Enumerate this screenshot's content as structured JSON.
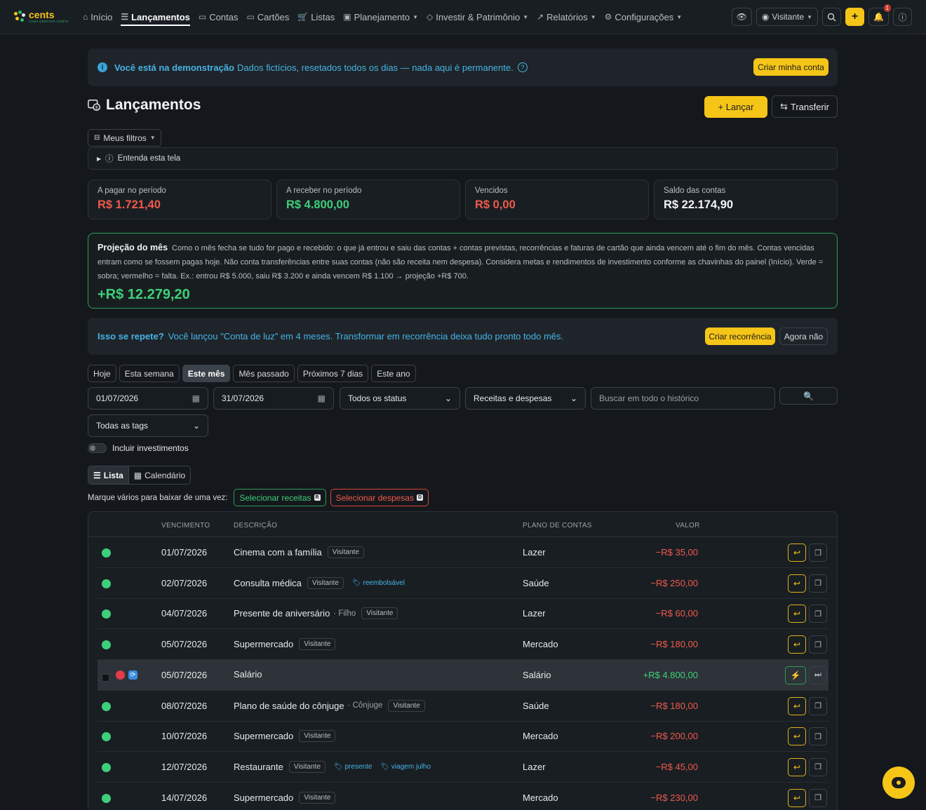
{
  "nav": {
    "logo": "cents",
    "logo_tagline": "CADA CENTAVO CONTA",
    "items": [
      {
        "label": "Início",
        "icon": "home-icon"
      },
      {
        "label": "Lançamentos",
        "icon": "list-icon"
      },
      {
        "label": "Contas",
        "icon": "folder-icon"
      },
      {
        "label": "Cartões",
        "icon": "card-icon"
      },
      {
        "label": "Listas",
        "icon": "cart-icon"
      },
      {
        "label": "Planejamento",
        "icon": "calendar-check-icon"
      },
      {
        "label": "Investir & Patrimônio",
        "icon": "gem-icon"
      },
      {
        "label": "Relatórios",
        "icon": "chart-icon"
      },
      {
        "label": "Configurações",
        "icon": "gear-icon"
      }
    ],
    "user": "Visitante",
    "notifications": "1"
  },
  "demo": {
    "title": "Você está na demonstração",
    "text": "Dados fictícios, resetados todos os dias — nada aqui é permanente.",
    "cta": "Criar minha conta"
  },
  "page": {
    "title": "Lançamentos",
    "launch": "+ Lançar",
    "transfer": "Transferir",
    "my_filters": "Meus filtros",
    "understand": "Entenda esta tela"
  },
  "summary": [
    {
      "label": "A pagar no período",
      "value": "R$ 1.721,40",
      "tone": "red"
    },
    {
      "label": "A receber no período",
      "value": "R$ 4.800,00",
      "tone": "green"
    },
    {
      "label": "Vencidos",
      "value": "R$ 0,00",
      "tone": "red"
    },
    {
      "label": "Saldo das contas",
      "value": "R$ 22.174,90",
      "tone": "white"
    }
  ],
  "projection": {
    "title": "Projeção do mês",
    "text": "Como o mês fecha se tudo for pago e recebido: o que já entrou e saiu das contas + contas previstas, recorrências e faturas de cartão que ainda vencem até o fim do mês. Contas vencidas entram como se fossem pagas hoje. Não conta transferências entre suas contas (não são receita nem despesa). Considera metas e rendimentos de investimento conforme as chavinhas do painel (Início). Verde = sobra; vermelho = falta. Ex.: entrou R$ 5.000, saiu R$ 3.200 e ainda vencem R$ 1.100 → projeção +R$ 700.",
    "value": "+R$ 12.279,20"
  },
  "recurrence": {
    "title": "Isso se repete?",
    "text": "Você lançou \"Conta de luz\" em 4 meses. Transformar em recorrência deixa tudo pronto todo mês.",
    "create": "Criar recorrência",
    "dismiss": "Agora não"
  },
  "periods": [
    "Hoje",
    "Esta semana",
    "Este mês",
    "Mês passado",
    "Próximos 7 dias",
    "Este ano"
  ],
  "filters": {
    "date_from": "01/07/2026",
    "date_to": "31/07/2026",
    "status": "Todos os status",
    "type": "Receitas e despesas",
    "search_placeholder": "Buscar em todo o histórico",
    "tags": "Todas as tags",
    "include_investments": "Incluir investimentos"
  },
  "views": {
    "list": "Lista",
    "calendar": "Calendário"
  },
  "bulk": {
    "label": "Marque vários para baixar de uma vez:",
    "select_income": "Selecionar receitas",
    "income_key": "R",
    "select_expense": "Selecionar despesas",
    "expense_key": "D"
  },
  "table": {
    "headers": {
      "due": "VENCIMENTO",
      "desc": "DESCRIÇÃO",
      "plan": "PLANO DE CONTAS",
      "value": "VALOR"
    },
    "rows": [
      {
        "date": "01/07/2026",
        "desc": "Cinema com a família",
        "sub": "",
        "pill": "Visitante",
        "tags": [],
        "plan": "Lazer",
        "value": "−R$ 35,00",
        "kind": "expense"
      },
      {
        "date": "02/07/2026",
        "desc": "Consulta médica",
        "sub": "",
        "pill": "Visitante",
        "tags": [
          "reembolsável"
        ],
        "plan": "Saúde",
        "value": "−R$ 250,00",
        "kind": "expense"
      },
      {
        "date": "04/07/2026",
        "desc": "Presente de aniversário",
        "sub": "· Filho",
        "pill": "Visitante",
        "tags": [],
        "plan": "Lazer",
        "value": "−R$ 60,00",
        "kind": "expense"
      },
      {
        "date": "05/07/2026",
        "desc": "Supermercado",
        "sub": "",
        "pill": "Visitante",
        "tags": [],
        "plan": "Mercado",
        "value": "−R$ 180,00",
        "kind": "expense"
      },
      {
        "date": "05/07/2026",
        "desc": "Salário",
        "sub": "",
        "pill": "",
        "tags": [],
        "plan": "Salário",
        "value": "+R$ 4.800,00",
        "kind": "income"
      },
      {
        "date": "08/07/2026",
        "desc": "Plano de saúde do cônjuge",
        "sub": "· Cônjuge",
        "pill": "Visitante",
        "tags": [],
        "plan": "Saúde",
        "value": "−R$ 180,00",
        "kind": "expense"
      },
      {
        "date": "10/07/2026",
        "desc": "Supermercado",
        "sub": "",
        "pill": "Visitante",
        "tags": [],
        "plan": "Mercado",
        "value": "−R$ 200,00",
        "kind": "expense"
      },
      {
        "date": "12/07/2026",
        "desc": "Restaurante",
        "sub": "",
        "pill": "Visitante",
        "tags": [
          "presente",
          "viagem julho"
        ],
        "plan": "Lazer",
        "value": "−R$ 45,00",
        "kind": "expense"
      },
      {
        "date": "14/07/2026",
        "desc": "Supermercado",
        "sub": "",
        "pill": "Visitante",
        "tags": [],
        "plan": "Mercado",
        "value": "−R$ 230,00",
        "kind": "expense"
      }
    ]
  }
}
